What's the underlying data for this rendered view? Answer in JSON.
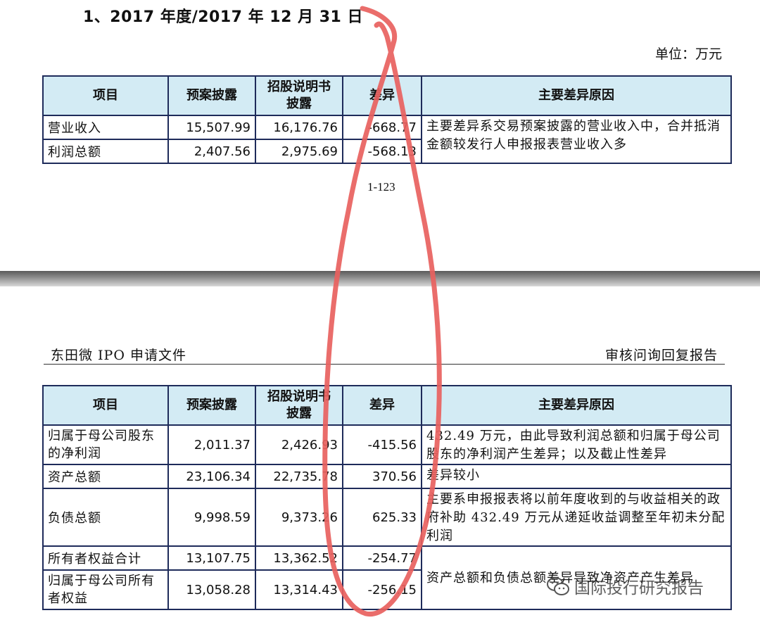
{
  "page1": {
    "section_title": "1、2017 年度/2017 年 12 月 31 日",
    "unit": "单位：万元",
    "page_number": "1-123"
  },
  "page2": {
    "header_left": "东田微 IPO 申请文件",
    "header_right": "审核问询回复报告"
  },
  "table_headers": {
    "item": "项目",
    "proposal": "预案披露",
    "prospectus_line1": "招股说明书",
    "prospectus_line2": "披露",
    "diff": "差异",
    "reason": "主要差异原因"
  },
  "table1": {
    "rows": [
      {
        "item": "营业收入",
        "proposal": "15,507.99",
        "prospectus": "16,176.76",
        "diff": "-668.77"
      },
      {
        "item": "利润总额",
        "proposal": "2,407.56",
        "prospectus": "2,975.69",
        "diff": "-568.13"
      }
    ],
    "reason": "主要差异系交易预案披露的营业收入中，合并抵消金额较发行人申报报表营业收入多"
  },
  "table2": {
    "rows": [
      {
        "item": "归属于母公司股东的净利润",
        "proposal": "2,011.37",
        "prospectus": "2,426.93",
        "diff": "-415.56",
        "reason": "432.49 万元，由此导致利润总额和归属于母公司股东的净利润产生差异；以及截止性差异"
      },
      {
        "item": "资产总额",
        "proposal": "23,106.34",
        "prospectus": "22,735.78",
        "diff": "370.56",
        "reason": "差异较小"
      },
      {
        "item": "负债总额",
        "proposal": "9,998.59",
        "prospectus": "9,373.26",
        "diff": "625.33",
        "reason": "主要系申报报表将以前年度收到的与收益相关的政府补助 432.49 万元从递延收益调整至年初未分配利润"
      },
      {
        "item": "所有者权益合计",
        "proposal": "13,107.75",
        "prospectus": "13,362.52",
        "diff": "-254.77",
        "reason": ""
      },
      {
        "item": "归属于母公司所有者权益",
        "proposal": "13,058.28",
        "prospectus": "13,314.43",
        "diff": "-256.15",
        "reason": "资产总额和负债总额差异导致净资产产生差异"
      }
    ]
  },
  "watermark": {
    "text": "国际投行研究报告",
    "icon": "wechat-icon"
  },
  "colors": {
    "header_bg": "#d3ebf4",
    "border": "#1e2b5a",
    "annotation": "#e8615e"
  }
}
